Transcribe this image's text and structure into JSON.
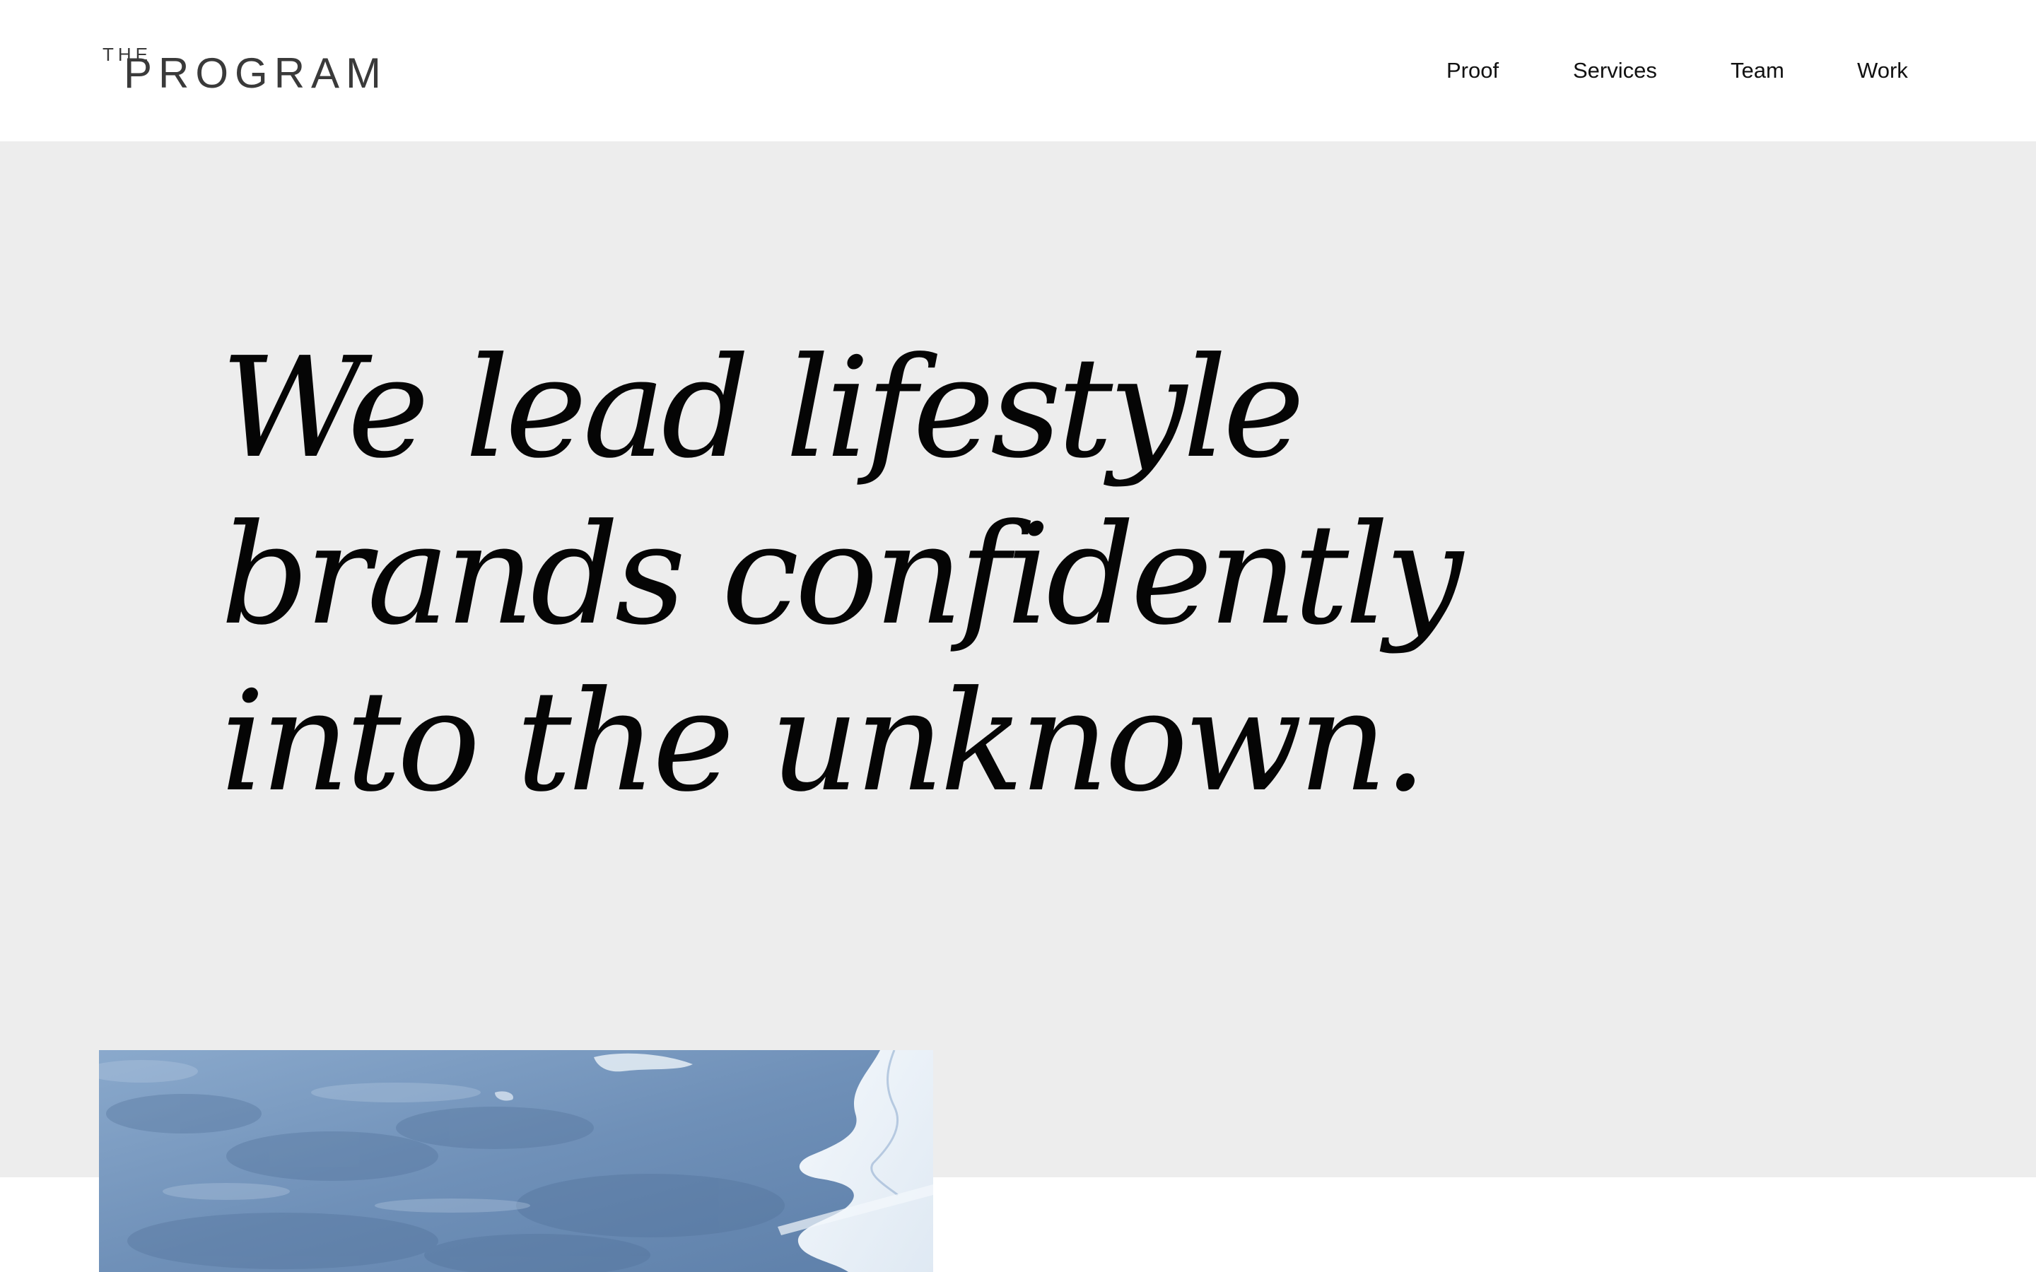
{
  "brand": {
    "logo_top": "THE",
    "logo_main": "PROGRAM"
  },
  "nav": {
    "items": [
      {
        "label": "Proof"
      },
      {
        "label": "Services"
      },
      {
        "label": "Team"
      },
      {
        "label": "Work"
      }
    ]
  },
  "hero": {
    "headline_lines": [
      "We lead lifestyle",
      "brands confidently",
      "into the unknown."
    ],
    "image": {
      "subject": "aerial-snowy-forest-river"
    }
  },
  "colors": {
    "hero_background": "#ededed",
    "page_background": "#ffffff",
    "text": "#050505",
    "logo": "#3a3a3a",
    "image_tint": "#7d9ec2"
  }
}
